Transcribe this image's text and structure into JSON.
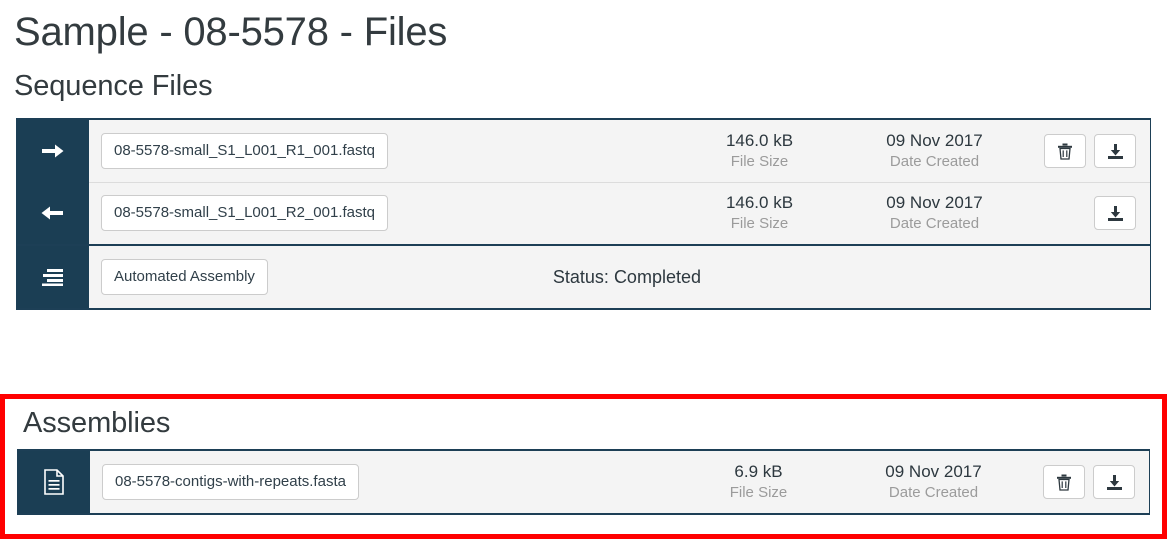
{
  "page": {
    "title": "Sample - 08-5578 - Files"
  },
  "sequence_section": {
    "heading": "Sequence Files",
    "rows": [
      {
        "icon": "arrow-right-icon",
        "filename": "08-5578-small_S1_L001_R1_001.fastq",
        "size_value": "146.0 kB",
        "size_label": "File Size",
        "date_value": "09 Nov 2017",
        "date_label": "Date Created",
        "has_delete": true,
        "has_download": true
      },
      {
        "icon": "arrow-left-icon",
        "filename": "08-5578-small_S1_L001_R2_001.fastq",
        "size_value": "146.0 kB",
        "size_label": "File Size",
        "date_value": "09 Nov 2017",
        "date_label": "Date Created",
        "has_delete": false,
        "has_download": true
      }
    ],
    "assembly_row": {
      "icon": "align-bars-icon",
      "label": "Automated Assembly",
      "status": "Status: Completed"
    }
  },
  "assemblies_section": {
    "heading": "Assemblies",
    "rows": [
      {
        "icon": "document-icon",
        "filename": "08-5578-contigs-with-repeats.fasta",
        "size_value": "6.9 kB",
        "size_label": "File Size",
        "date_value": "09 Nov 2017",
        "date_label": "Date Created",
        "has_delete": true,
        "has_download": true
      }
    ]
  },
  "icons": {
    "delete": "trash-icon",
    "download": "download-icon"
  },
  "colors": {
    "navy": "#1b3e54",
    "row_bg": "#f4f4f4",
    "highlight": "#ff0000",
    "muted_text": "#9b9b9b"
  }
}
